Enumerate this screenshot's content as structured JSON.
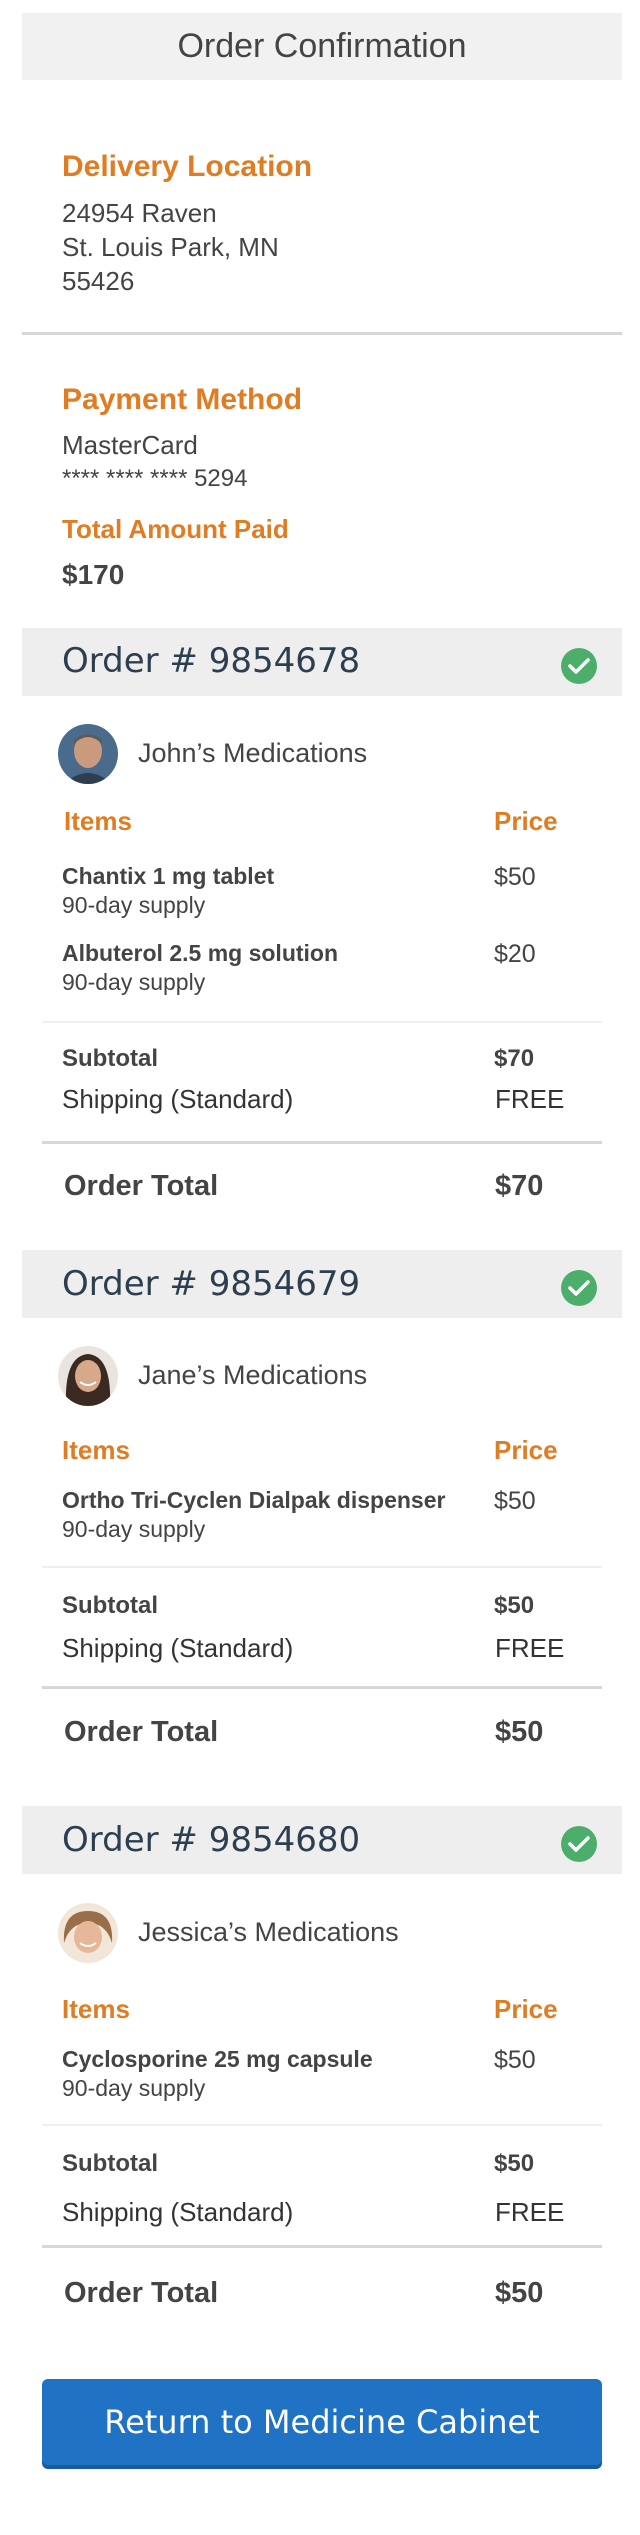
{
  "header": {
    "title": "Order Confirmation"
  },
  "delivery": {
    "title": "Delivery Location",
    "line1": "24954 Raven",
    "line2": "St. Louis Park, MN",
    "line3": "55426"
  },
  "payment": {
    "title": "Payment Method",
    "card": "MasterCard",
    "masked": "**** **** **** 5294",
    "total_title": "Total Amount Paid",
    "total_value": "$170"
  },
  "orders": [
    {
      "number": "Order # 9854678",
      "person": "John’s Medications",
      "items_header": "Items",
      "price_header": "Price",
      "items": [
        {
          "name": "Chantix 1 mg tablet",
          "supply": "90-day supply",
          "price": "$50"
        },
        {
          "name": "Albuterol 2.5 mg solution",
          "supply": "90-day supply",
          "price": "$20"
        }
      ],
      "subtotal_label": "Subtotal",
      "subtotal": "$70",
      "shipping_label": "Shipping (Standard)",
      "shipping": "FREE",
      "total_label": "Order Total",
      "total": "$70"
    },
    {
      "number": "Order # 9854679",
      "person": "Jane’s Medications",
      "items_header": "Items",
      "price_header": "Price",
      "items": [
        {
          "name": "Ortho Tri-Cyclen Dialpak dispenser",
          "supply": "90-day supply",
          "price": "$50"
        }
      ],
      "subtotal_label": "Subtotal",
      "subtotal": "$50",
      "shipping_label": "Shipping (Standard)",
      "shipping": "FREE",
      "total_label": "Order Total",
      "total": "$50"
    },
    {
      "number": "Order # 9854680",
      "person": "Jessica’s Medications",
      "items_header": "Items",
      "price_header": "Price",
      "items": [
        {
          "name": "Cyclosporine 25 mg capsule",
          "supply": "90-day supply",
          "price": "$50"
        }
      ],
      "subtotal_label": "Subtotal",
      "subtotal": "$50",
      "shipping_label": "Shipping (Standard)",
      "shipping": "FREE",
      "total_label": "Order Total",
      "total": "$50"
    }
  ],
  "cta": {
    "label": "Return to Medicine Cabinet"
  },
  "colors": {
    "accent": "#e07c22",
    "primary": "#1f72c4",
    "success": "#4cae6a"
  },
  "icons": {
    "order_status": "check-circle-icon"
  }
}
